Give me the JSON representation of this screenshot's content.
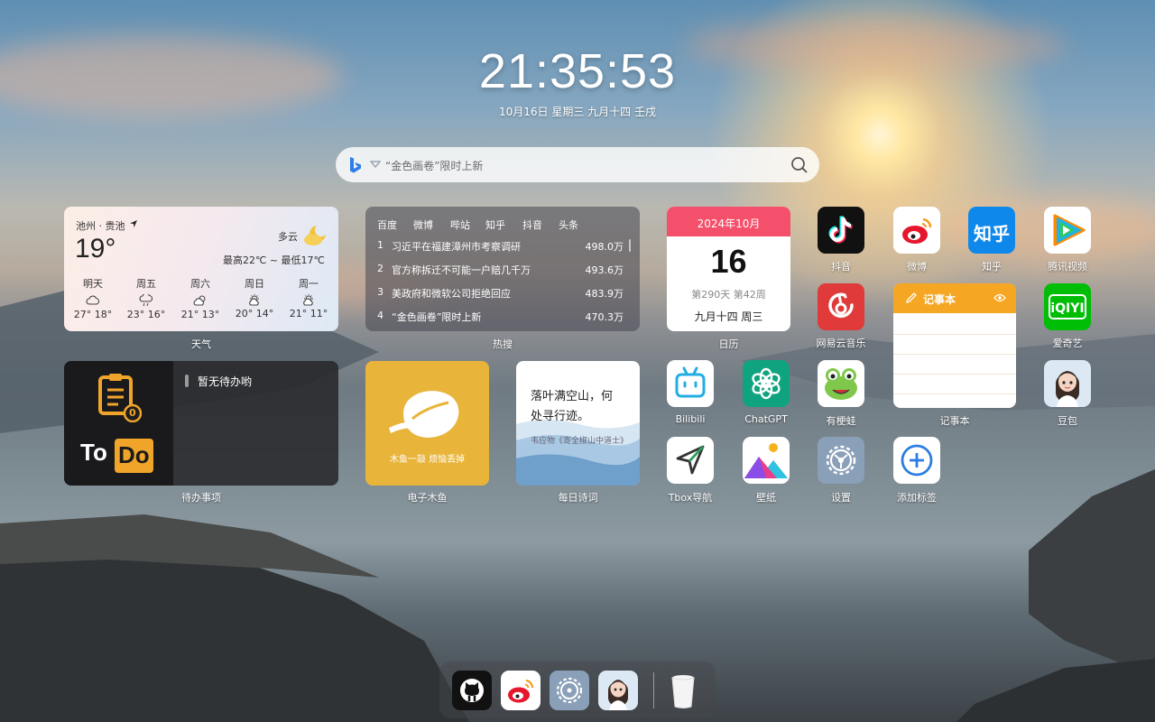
{
  "clock": {
    "time": "21:35:53",
    "date": "10月16日  星期三  九月十四  壬戌"
  },
  "search": {
    "placeholder": "“金色画卷”限时上新"
  },
  "weather": {
    "location": "池州 · 贵池",
    "temperature": "19°",
    "condition": "多云",
    "range": "最高22℃ ~ 最低17℃",
    "forecast": [
      {
        "day": "明天",
        "temps": "27° 18°"
      },
      {
        "day": "周五",
        "temps": "23° 16°"
      },
      {
        "day": "周六",
        "temps": "21° 13°"
      },
      {
        "day": "周日",
        "temps": "20° 14°"
      },
      {
        "day": "周一",
        "temps": "21° 11°"
      }
    ],
    "label": "天气"
  },
  "hot": {
    "tabs": [
      "百度",
      "微博",
      "哔站",
      "知乎",
      "抖音",
      "头条"
    ],
    "rows": [
      {
        "rank": "1",
        "title": "习近平在福建漳州市考察调研",
        "value": "498.0万"
      },
      {
        "rank": "2",
        "title": "官方称拆迁不可能一户赔几千万",
        "value": "493.6万"
      },
      {
        "rank": "3",
        "title": "美政府和微软公司拒绝回应",
        "value": "483.9万"
      },
      {
        "rank": "4",
        "title": "“金色画卷”限时上新",
        "value": "470.3万"
      }
    ],
    "label": "热搜"
  },
  "calendar": {
    "month": "2024年10月",
    "day": "16",
    "info": "第290天 第42周",
    "lunar": "九月十四 周三",
    "label": "日历"
  },
  "todo": {
    "empty": "暂无待办哟",
    "badge": "0",
    "logo_a": "To",
    "logo_b": "Do",
    "label": "待办事项"
  },
  "muyu": {
    "caption": "木鱼一敲 烦恼丢掉",
    "label": "电子木鱼"
  },
  "poem": {
    "line1": "落叶满空山，何",
    "line2": "处寻行迹。",
    "source": "韦应物《寄全椒山中道士》",
    "label": "每日诗词"
  },
  "notes": {
    "title": "记事本",
    "label": "记事本"
  },
  "apps": {
    "douyin": "抖音",
    "weibo": "微博",
    "zhihu": "知乎",
    "zhihu_text": "知乎",
    "tencent": "腾讯视频",
    "netease": "网易云音乐",
    "iqiyi": "爱奇艺",
    "bilibili": "Bilibili",
    "chatgpt": "ChatGPT",
    "frog": "有梗蛙",
    "doubao": "豆包",
    "tbox": "Tbox导航",
    "wallpaper": "壁纸",
    "settings": "设置",
    "add": "添加标签"
  },
  "colors": {
    "calendar_header": "#f4506b",
    "notes_header": "#f5a623",
    "muyu_bg": "#e8b43a",
    "zhihu_blue": "#0f88eb",
    "weibo_red": "#e6162d",
    "iqiyi_green": "#00be06"
  }
}
